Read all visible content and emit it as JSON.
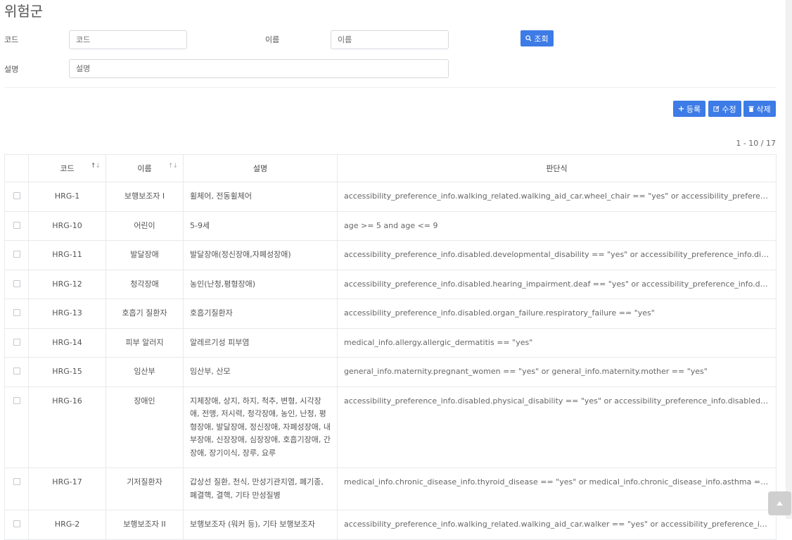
{
  "page": {
    "title": "위험군"
  },
  "search": {
    "code_label": "코드",
    "code_placeholder": "코드",
    "name_label": "이름",
    "name_placeholder": "이름",
    "desc_label": "설명",
    "desc_placeholder": "설명",
    "search_button": "조회"
  },
  "toolbar": {
    "register": "등록",
    "edit": "수정",
    "delete": "삭제"
  },
  "pagination": {
    "range": "1 - 10 / 17"
  },
  "table": {
    "headers": {
      "code": "코드",
      "name": "이름",
      "desc": "설명",
      "formula": "판단식"
    },
    "rows": [
      {
        "code": "HRG-1",
        "name": "보행보조자 I",
        "desc": "휠체어, 전동휠체어",
        "formula": "accessibility_preference_info.walking_related.walking_aid_car.wheel_chair == \"yes\" or accessibility_preference_info.walking_related.walking_aid_car.electric_wheel_chair == \"yes\""
      },
      {
        "code": "HRG-10",
        "name": "어린이",
        "desc": "5-9세",
        "formula": "age >= 5 and age <= 9"
      },
      {
        "code": "HRG-11",
        "name": "발달장애",
        "desc": "발달장애(정신장애,자폐성장애)",
        "formula": "accessibility_preference_info.disabled.developmental_disability == \"yes\" or accessibility_preference_info.disabled.mental_disability == \"yes\""
      },
      {
        "code": "HRG-12",
        "name": "청각장애",
        "desc": "농인(난청,평형장애)",
        "formula": "accessibility_preference_info.disabled.hearing_impairment.deaf == \"yes\" or accessibility_preference_info.disabled.hearing_impairment.balance == \"yes\""
      },
      {
        "code": "HRG-13",
        "name": "호흡기 질환자",
        "desc": "호흡기질환자",
        "formula": "accessibility_preference_info.disabled.organ_failure.respiratory_failure == \"yes\""
      },
      {
        "code": "HRG-14",
        "name": "피부 알러지",
        "desc": "알레르기성 피부염",
        "formula": "medical_info.allergy.allergic_dermatitis == \"yes\""
      },
      {
        "code": "HRG-15",
        "name": "임산부",
        "desc": "임산부, 산모",
        "formula": "general_info.maternity.pregnant_women == \"yes\" or general_info.maternity.mother == \"yes\""
      },
      {
        "code": "HRG-16",
        "name": "장애인",
        "desc": "지체장애, 상지, 하지, 척추, 변형, 시각장애, 전맹, 저시력, 청각장애, 농인, 난청, 평형장애, 발달장애, 정신장애, 자폐성장애, 내부장애, 신장장애, 심장장애, 호흡기장애, 간장애, 장기이식, 장루, 요루",
        "formula": "accessibility_preference_info.disabled.physical_disability == \"yes\" or accessibility_preference_info.disabled.physical_disability.upper_limb == \"yes\""
      },
      {
        "code": "HRG-17",
        "name": "기저질환자",
        "desc": "갑상선 질환, 천식, 만성기관지염, 폐기종, 폐결핵, 결핵, 기타 만성질병",
        "formula": "medical_info.chronic_disease_info.thyroid_disease == \"yes\" or medical_info.chronic_disease_info.asthma == \"yes\""
      },
      {
        "code": "HRG-2",
        "name": "보행보조자 II",
        "desc": "보행보조자 (워커 등), 기타 보행보조자",
        "formula": "accessibility_preference_info.walking_related.walking_aid_car.walker == \"yes\" or accessibility_preference_info.walking_related.walking_aid_car.etc == \"yes\""
      }
    ]
  }
}
